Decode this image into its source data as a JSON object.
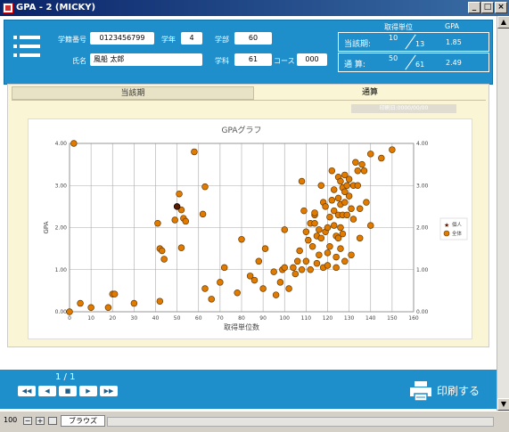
{
  "window": {
    "title": "GPA - 2 (MICKY)"
  },
  "header": {
    "student_id_label": "学籍番号",
    "student_id": "0123456799",
    "grade_label": "学年",
    "grade": "4",
    "faculty_label": "学部",
    "faculty": "60",
    "name_label": "氏名",
    "name": "風船 太郎",
    "dept_label": "学科",
    "dept": "61",
    "course_label": "コース",
    "course": "000"
  },
  "stats": {
    "credits_header": "取得単位",
    "gpa_header": "GPA",
    "current_label": "当該期:",
    "current_earned": "10",
    "current_total": "13",
    "current_gpa": "1.85",
    "overall_label": "通 算:",
    "overall_earned": "50",
    "overall_total": "61",
    "overall_gpa": "2.49"
  },
  "tabs": {
    "current": "当該期",
    "all": "通算"
  },
  "print_note": "印刷日:0000/00/00",
  "footer": {
    "page": "1 / 1",
    "print_label": "印刷する"
  },
  "statusbar": {
    "zoom": "100",
    "mode": "ブラウズ"
  },
  "colors": {
    "accent": "#1e8fcb",
    "point": "#e07b00",
    "self": "#5a1a00"
  },
  "chart_data": {
    "type": "scatter",
    "title": "GPAグラフ",
    "xlabel": "取得単位数",
    "ylabel": "GPA",
    "xlim": [
      0,
      160
    ],
    "ylim": [
      0,
      4
    ],
    "xticks": [
      0,
      10,
      20,
      30,
      40,
      50,
      60,
      70,
      80,
      90,
      100,
      110,
      120,
      130,
      140,
      150,
      160
    ],
    "yticks": [
      0,
      1,
      2,
      3,
      4
    ],
    "grid": true,
    "legend": "right",
    "series": [
      {
        "name": "個人",
        "points": [
          [
            50,
            2.5
          ]
        ]
      },
      {
        "name": "全体",
        "points": [
          [
            2,
            4.0
          ],
          [
            0,
            0
          ],
          [
            5,
            0.2
          ],
          [
            10,
            0.1
          ],
          [
            18,
            0.1
          ],
          [
            20,
            0.42
          ],
          [
            21,
            0.42
          ],
          [
            30,
            0.2
          ],
          [
            42,
            0.25
          ],
          [
            41,
            2.1
          ],
          [
            42,
            1.5
          ],
          [
            43,
            1.45
          ],
          [
            44,
            1.25
          ],
          [
            49,
            2.18
          ],
          [
            51,
            2.8
          ],
          [
            52,
            1.52
          ],
          [
            52,
            2.42
          ],
          [
            53,
            2.22
          ],
          [
            54,
            2.15
          ],
          [
            58,
            3.8
          ],
          [
            62,
            2.32
          ],
          [
            63,
            2.97
          ],
          [
            63,
            0.55
          ],
          [
            66,
            0.3
          ],
          [
            70,
            0.7
          ],
          [
            72,
            1.05
          ],
          [
            78,
            0.45
          ],
          [
            80,
            1.72
          ],
          [
            84,
            0.85
          ],
          [
            86,
            0.75
          ],
          [
            88,
            1.2
          ],
          [
            90,
            0.55
          ],
          [
            91,
            1.5
          ],
          [
            95,
            0.95
          ],
          [
            96,
            0.4
          ],
          [
            98,
            0.7
          ],
          [
            99,
            1.0
          ],
          [
            100,
            1.05
          ],
          [
            100,
            1.95
          ],
          [
            102,
            0.55
          ],
          [
            104,
            1.05
          ],
          [
            105,
            0.9
          ],
          [
            106,
            1.2
          ],
          [
            107,
            1.45
          ],
          [
            108,
            1.0
          ],
          [
            108,
            3.1
          ],
          [
            109,
            2.4
          ],
          [
            110,
            1.9
          ],
          [
            110,
            1.2
          ],
          [
            111,
            1.7
          ],
          [
            112,
            1.0
          ],
          [
            112,
            2.1
          ],
          [
            113,
            1.55
          ],
          [
            114,
            2.3
          ],
          [
            114,
            2.1
          ],
          [
            114,
            2.35
          ],
          [
            115,
            1.8
          ],
          [
            115,
            1.15
          ],
          [
            116,
            1.95
          ],
          [
            116,
            1.35
          ],
          [
            117,
            3.0
          ],
          [
            117,
            1.75
          ],
          [
            118,
            1.05
          ],
          [
            118,
            2.6
          ],
          [
            119,
            1.9
          ],
          [
            119,
            2.5
          ],
          [
            120,
            2.0
          ],
          [
            120,
            1.4
          ],
          [
            120,
            1.1
          ],
          [
            121,
            2.25
          ],
          [
            121,
            1.55
          ],
          [
            122,
            3.35
          ],
          [
            122,
            2.65
          ],
          [
            123,
            2.9
          ],
          [
            123,
            2.4
          ],
          [
            123,
            2.05
          ],
          [
            124,
            1.8
          ],
          [
            124,
            1.3
          ],
          [
            124,
            1.05
          ],
          [
            125,
            3.2
          ],
          [
            125,
            2.7
          ],
          [
            125,
            2.3
          ],
          [
            125,
            1.75
          ],
          [
            126,
            3.1
          ],
          [
            126,
            2.55
          ],
          [
            126,
            2.0
          ],
          [
            126,
            1.5
          ],
          [
            127,
            2.95
          ],
          [
            127,
            2.3
          ],
          [
            127,
            1.85
          ],
          [
            128,
            3.25
          ],
          [
            128,
            2.85
          ],
          [
            128,
            2.6
          ],
          [
            128,
            1.2
          ],
          [
            129,
            3.0
          ],
          [
            129,
            2.3
          ],
          [
            130,
            3.15
          ],
          [
            130,
            2.75
          ],
          [
            131,
            2.45
          ],
          [
            131,
            1.35
          ],
          [
            132,
            3.0
          ],
          [
            132,
            2.2
          ],
          [
            133,
            3.55
          ],
          [
            134,
            3.0
          ],
          [
            134,
            3.35
          ],
          [
            135,
            2.45
          ],
          [
            135,
            1.75
          ],
          [
            136,
            3.5
          ],
          [
            137,
            3.35
          ],
          [
            138,
            2.6
          ],
          [
            140,
            3.75
          ],
          [
            140,
            2.05
          ],
          [
            145,
            3.65
          ],
          [
            150,
            3.85
          ]
        ]
      }
    ]
  }
}
